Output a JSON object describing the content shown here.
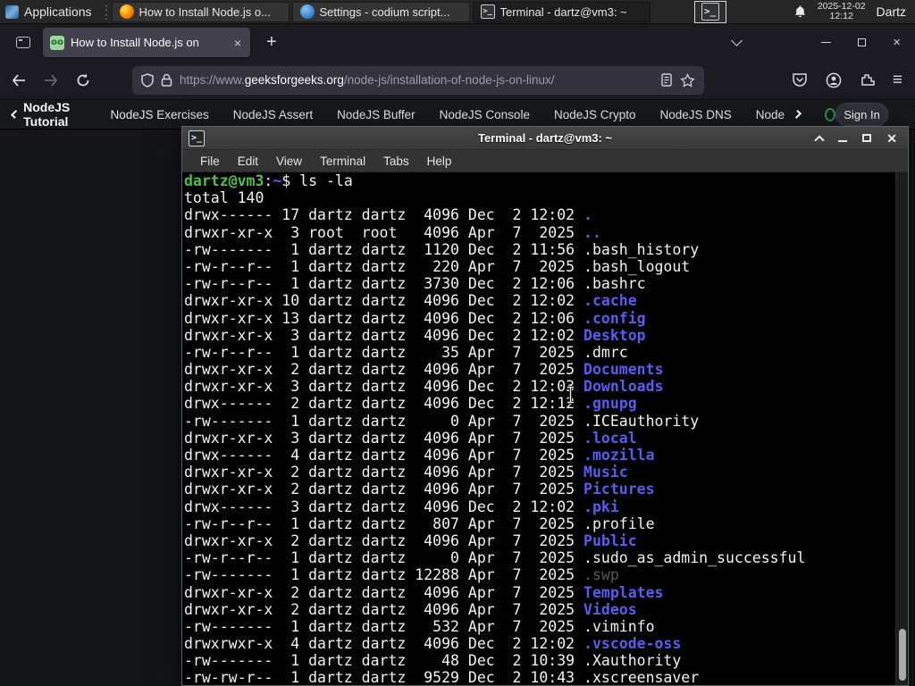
{
  "panel": {
    "applications_label": "Applications",
    "window_buttons": [
      {
        "title": "How to Install Node.js o...",
        "icon": "firefox-icon",
        "active": false
      },
      {
        "title": "Settings - codium script...",
        "icon": "codium-icon",
        "active": false
      },
      {
        "title": "Terminal - dartz@vm3: ~",
        "icon": "terminal-icon",
        "active": true
      }
    ],
    "tray_terminal_glyph": ">_",
    "clock_date": "2025-12-02",
    "clock_time": "12:12",
    "user": "Dartz"
  },
  "browser": {
    "tab_title": "How to Install Node.js on",
    "tab_close_glyph": "×",
    "new_tab_label": "+",
    "favicon_glyph": "oo",
    "url": {
      "prefix": "https://www.",
      "domain": "geeksforgeeks.org",
      "path": "/node-js/installation-of-node-js-on-linux/"
    },
    "window_close_glyph": "×"
  },
  "site_nav": {
    "back_label": "NodeJS Tutorial",
    "links": [
      "NodeJS Exercises",
      "NodeJS Assert",
      "NodeJS Buffer",
      "NodeJS Console",
      "NodeJS Crypto",
      "NodeJS DNS",
      "Node"
    ],
    "signin_label": "Sign In",
    "accent_green": "#2f8d46"
  },
  "terminal": {
    "title": "Terminal - dartz@vm3: ~",
    "icon_glyph": ">_",
    "close_glyph": "✕",
    "menu": [
      "File",
      "Edit",
      "View",
      "Terminal",
      "Tabs",
      "Help"
    ],
    "colors": {
      "background": "#000000",
      "foreground": "#f2f2f2",
      "prompt_green": "#4cc04c",
      "dir_blue": "#5a5cf0",
      "dim": "#585858"
    },
    "lines": [
      [
        {
          "t": "dartz@vm3",
          "c": "g"
        },
        {
          "t": ":",
          "c": "w"
        },
        {
          "t": "~",
          "c": "b"
        },
        {
          "t": "$ ls -la",
          "c": "w"
        }
      ],
      [
        {
          "t": "total 140",
          "c": "w"
        }
      ],
      [
        {
          "t": "drwx------ 17 dartz dartz  4096 Dec  2 12:02 ",
          "c": "w"
        },
        {
          "t": ".",
          "c": "b"
        }
      ],
      [
        {
          "t": "drwxr-xr-x  3 root  root   4096 Apr  7  2025 ",
          "c": "w"
        },
        {
          "t": "..",
          "c": "b"
        }
      ],
      [
        {
          "t": "-rw-------  1 dartz dartz  1120 Dec  2 11:56 ",
          "c": "w"
        },
        {
          "t": ".bash_history",
          "c": "w"
        }
      ],
      [
        {
          "t": "-rw-r--r--  1 dartz dartz   220 Apr  7  2025 ",
          "c": "w"
        },
        {
          "t": ".bash_logout",
          "c": "w"
        }
      ],
      [
        {
          "t": "-rw-r--r--  1 dartz dartz  3730 Dec  2 12:06 ",
          "c": "w"
        },
        {
          "t": ".bashrc",
          "c": "w"
        }
      ],
      [
        {
          "t": "drwxr-xr-x 10 dartz dartz  4096 Dec  2 12:02 ",
          "c": "w"
        },
        {
          "t": ".cache",
          "c": "b"
        }
      ],
      [
        {
          "t": "drwxr-xr-x 13 dartz dartz  4096 Dec  2 12:06 ",
          "c": "w"
        },
        {
          "t": ".config",
          "c": "b"
        }
      ],
      [
        {
          "t": "drwxr-xr-x  3 dartz dartz  4096 Dec  2 12:02 ",
          "c": "w"
        },
        {
          "t": "Desktop",
          "c": "b"
        }
      ],
      [
        {
          "t": "-rw-r--r--  1 dartz dartz    35 Apr  7  2025 ",
          "c": "w"
        },
        {
          "t": ".dmrc",
          "c": "w"
        }
      ],
      [
        {
          "t": "drwxr-xr-x  2 dartz dartz  4096 Apr  7  2025 ",
          "c": "w"
        },
        {
          "t": "Documents",
          "c": "b"
        }
      ],
      [
        {
          "t": "drwxr-xr-x  3 dartz dartz  4096 Dec  2 12:03 ",
          "c": "w"
        },
        {
          "t": "Downloads",
          "c": "b"
        }
      ],
      [
        {
          "t": "drwx------  2 dartz dartz  4096 Dec  2 12:12 ",
          "c": "w"
        },
        {
          "t": ".gnupg",
          "c": "b"
        }
      ],
      [
        {
          "t": "-rw-------  1 dartz dartz     0 Apr  7  2025 ",
          "c": "w"
        },
        {
          "t": ".ICEauthority",
          "c": "w"
        }
      ],
      [
        {
          "t": "drwxr-xr-x  3 dartz dartz  4096 Apr  7  2025 ",
          "c": "w"
        },
        {
          "t": ".local",
          "c": "b"
        }
      ],
      [
        {
          "t": "drwx------  4 dartz dartz  4096 Apr  7  2025 ",
          "c": "w"
        },
        {
          "t": ".mozilla",
          "c": "b"
        }
      ],
      [
        {
          "t": "drwxr-xr-x  2 dartz dartz  4096 Apr  7  2025 ",
          "c": "w"
        },
        {
          "t": "Music",
          "c": "b"
        }
      ],
      [
        {
          "t": "drwxr-xr-x  2 dartz dartz  4096 Apr  7  2025 ",
          "c": "w"
        },
        {
          "t": "Pictures",
          "c": "b"
        }
      ],
      [
        {
          "t": "drwx------  3 dartz dartz  4096 Dec  2 12:02 ",
          "c": "w"
        },
        {
          "t": ".pki",
          "c": "b"
        }
      ],
      [
        {
          "t": "-rw-r--r--  1 dartz dartz   807 Apr  7  2025 ",
          "c": "w"
        },
        {
          "t": ".profile",
          "c": "w"
        }
      ],
      [
        {
          "t": "drwxr-xr-x  2 dartz dartz  4096 Apr  7  2025 ",
          "c": "w"
        },
        {
          "t": "Public",
          "c": "b"
        }
      ],
      [
        {
          "t": "-rw-r--r--  1 dartz dartz     0 Apr  7  2025 ",
          "c": "w"
        },
        {
          "t": ".sudo_as_admin_successful",
          "c": "w"
        }
      ],
      [
        {
          "t": "-rw-------  1 dartz dartz 12288 Apr  7  2025 ",
          "c": "w"
        },
        {
          "t": ".swp",
          "c": "d"
        }
      ],
      [
        {
          "t": "drwxr-xr-x  2 dartz dartz  4096 Apr  7  2025 ",
          "c": "w"
        },
        {
          "t": "Templates",
          "c": "b"
        }
      ],
      [
        {
          "t": "drwxr-xr-x  2 dartz dartz  4096 Apr  7  2025 ",
          "c": "w"
        },
        {
          "t": "Videos",
          "c": "b"
        }
      ],
      [
        {
          "t": "-rw-------  1 dartz dartz   532 Apr  7  2025 ",
          "c": "w"
        },
        {
          "t": ".viminfo",
          "c": "w"
        }
      ],
      [
        {
          "t": "drwxrwxr-x  4 dartz dartz  4096 Dec  2 12:02 ",
          "c": "w"
        },
        {
          "t": ".vscode-oss",
          "c": "b"
        }
      ],
      [
        {
          "t": "-rw-------  1 dartz dartz    48 Dec  2 10:39 ",
          "c": "w"
        },
        {
          "t": ".Xauthority",
          "c": "w"
        }
      ],
      [
        {
          "t": "-rw-rw-r--  1 dartz dartz  9529 Dec  2 10:43 ",
          "c": "w"
        },
        {
          "t": ".xscreensaver",
          "c": "w"
        }
      ]
    ]
  }
}
